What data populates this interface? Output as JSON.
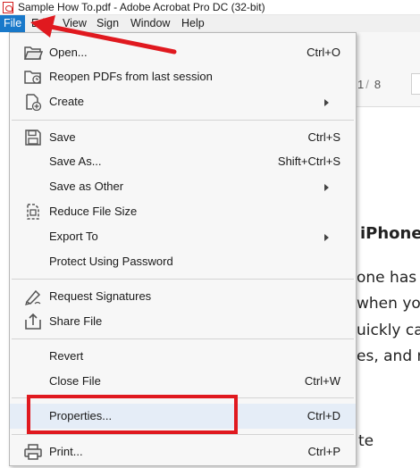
{
  "window": {
    "title": "Sample How To.pdf - Adobe Acrobat Pro DC (32-bit)"
  },
  "menubar": {
    "items": [
      {
        "label": "File",
        "active": true
      },
      {
        "label": "Edit"
      },
      {
        "label": "View"
      },
      {
        "label": "Sign"
      },
      {
        "label": "Window"
      },
      {
        "label": "Help"
      }
    ]
  },
  "page_nav": {
    "current": "1",
    "separator": "/",
    "total": "8"
  },
  "document": {
    "heading_fragment": "iPhone",
    "lines": [
      "one has",
      "when you",
      "uickly  ca",
      "es, and n",
      "te"
    ]
  },
  "file_menu": {
    "items": [
      {
        "label": "Open...",
        "shortcut": "Ctrl+O",
        "icon": "open-folder-icon"
      },
      {
        "label": "Reopen PDFs from last session",
        "shortcut": "",
        "icon": "reopen-folder-icon"
      },
      {
        "label": "Create",
        "shortcut": "",
        "icon": "create-pdf-icon",
        "submenu": true
      },
      {
        "label": "Save",
        "shortcut": "Ctrl+S",
        "icon": "save-icon"
      },
      {
        "label": "Save As...",
        "shortcut": "Shift+Ctrl+S",
        "icon": ""
      },
      {
        "label": "Save as Other",
        "shortcut": "",
        "icon": "",
        "submenu": true
      },
      {
        "label": "Reduce File Size",
        "shortcut": "",
        "icon": "reduce-size-icon"
      },
      {
        "label": "Export To",
        "shortcut": "",
        "icon": "",
        "submenu": true
      },
      {
        "label": "Protect Using Password",
        "shortcut": "",
        "icon": ""
      },
      {
        "label": "Request Signatures",
        "shortcut": "",
        "icon": "signature-pen-icon"
      },
      {
        "label": "Share File",
        "shortcut": "",
        "icon": "share-icon"
      },
      {
        "label": "Revert",
        "shortcut": "",
        "icon": ""
      },
      {
        "label": "Close File",
        "shortcut": "Ctrl+W",
        "icon": ""
      },
      {
        "label": "Properties...",
        "shortcut": "Ctrl+D",
        "icon": "",
        "highlighted": true
      },
      {
        "label": "Print...",
        "shortcut": "Ctrl+P",
        "icon": "printer-icon"
      }
    ]
  },
  "colors": {
    "accent": "#1979ca",
    "annotation_red": "#e0191f",
    "menu_bg": "#f7f7f7",
    "hover_bg": "#e5edf7"
  }
}
